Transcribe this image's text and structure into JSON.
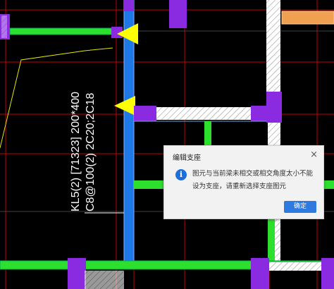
{
  "drawing": {
    "beam_label_line1": "KL5(2) [71323] 200*400",
    "beam_label_line2": "C8@100(2) 2C20;2C18"
  },
  "dialog": {
    "title": "编辑支座",
    "close_glyph": "×",
    "icon": "info-icon",
    "icon_glyph": "i",
    "message": "图元与当前梁未相交或相交角度太小不能设为支座，请重新选择支座图元",
    "ok_label": "确定"
  },
  "colors": {
    "background": "#000000",
    "wall_purple": "#8a2be2",
    "beam_blue": "#1f78e8",
    "beam_green": "#2ee02e",
    "support_marker_yellow": "#ffff00",
    "grid_red": "#cc0000",
    "dialog_button": "#2f7ae0"
  }
}
